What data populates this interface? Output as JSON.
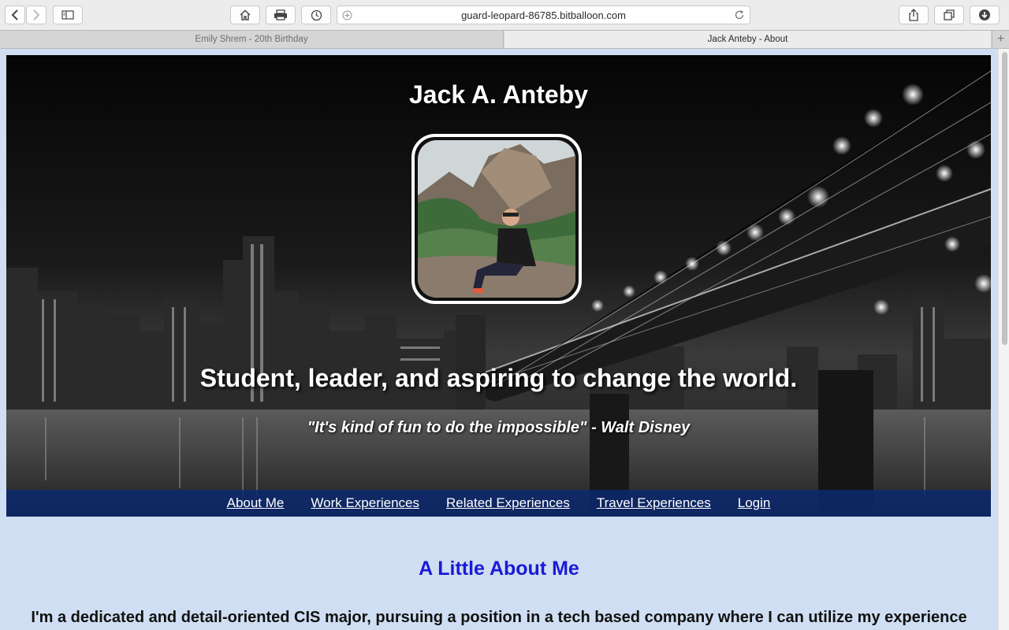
{
  "browser": {
    "url": "guard-leopard-86785.bitballoon.com",
    "tabs": [
      {
        "label": "Emily Shrem - 20th Birthday",
        "active": false
      },
      {
        "label": "Jack Anteby - About",
        "active": true
      }
    ],
    "tab_add": "+"
  },
  "hero": {
    "title": "Jack A. Anteby",
    "tagline": "Student, leader, and aspiring to change the world.",
    "quote": "\"It's kind of fun to do the impossible\" - Walt Disney"
  },
  "nav": {
    "items": [
      {
        "label": "About Me"
      },
      {
        "label": "Work Experiences"
      },
      {
        "label": "Related Experiences"
      },
      {
        "label": "Travel Experiences"
      },
      {
        "label": "Login"
      }
    ]
  },
  "about": {
    "heading": "A Little About Me",
    "body": "I'm a dedicated and detail-oriented CIS major, pursuing a position in a tech based company where I can utilize my experience and my knowledge of computer information systems."
  },
  "colors": {
    "page_bg": "#cfdef2",
    "nav_bg": "#0c286e",
    "heading": "#1a1ad6"
  }
}
